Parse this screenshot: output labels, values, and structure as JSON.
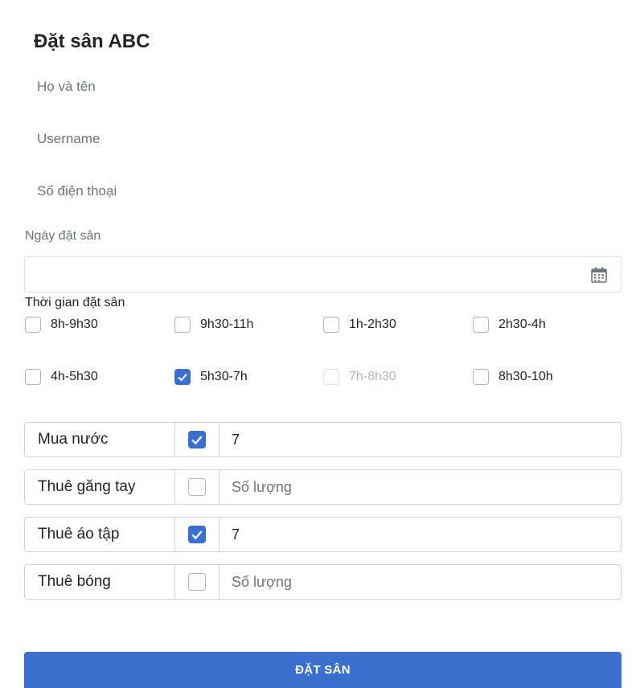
{
  "form": {
    "title": "Đặt sân ABC",
    "full_name_placeholder": "Họ và tên",
    "username_placeholder": "Username",
    "phone_placeholder": "Số điện thoại",
    "date_label": "Ngày đặt sân",
    "date_value": "",
    "time_label": "Thời gian đặt sân",
    "time_slots": [
      {
        "label": "8h-9h30",
        "checked": false,
        "disabled": false
      },
      {
        "label": "9h30-11h",
        "checked": false,
        "disabled": false
      },
      {
        "label": "1h-2h30",
        "checked": false,
        "disabled": false
      },
      {
        "label": "2h30-4h",
        "checked": false,
        "disabled": false
      },
      {
        "label": "4h-5h30",
        "checked": false,
        "disabled": false
      },
      {
        "label": "5h30-7h",
        "checked": true,
        "disabled": false
      },
      {
        "label": "7h-8h30",
        "checked": false,
        "disabled": true
      },
      {
        "label": "8h30-10h",
        "checked": false,
        "disabled": false
      }
    ],
    "extras": [
      {
        "label": "Mua nước",
        "checked": true,
        "value": "7",
        "placeholder": "Số lượng"
      },
      {
        "label": "Thuê găng tay",
        "checked": false,
        "value": "",
        "placeholder": "Số lượng"
      },
      {
        "label": "Thuê áo tập",
        "checked": true,
        "value": "7",
        "placeholder": "Số lượng"
      },
      {
        "label": "Thuê bóng",
        "checked": false,
        "value": "",
        "placeholder": "Số lượng"
      }
    ],
    "submit_label": "ĐẶT SÂN",
    "icons": {
      "date": "calendar-icon",
      "check": "checkmark-icon"
    },
    "colors": {
      "accent": "#3a6fcf",
      "text": "#212529",
      "muted": "#6c757d",
      "border": "#ced4da"
    }
  }
}
